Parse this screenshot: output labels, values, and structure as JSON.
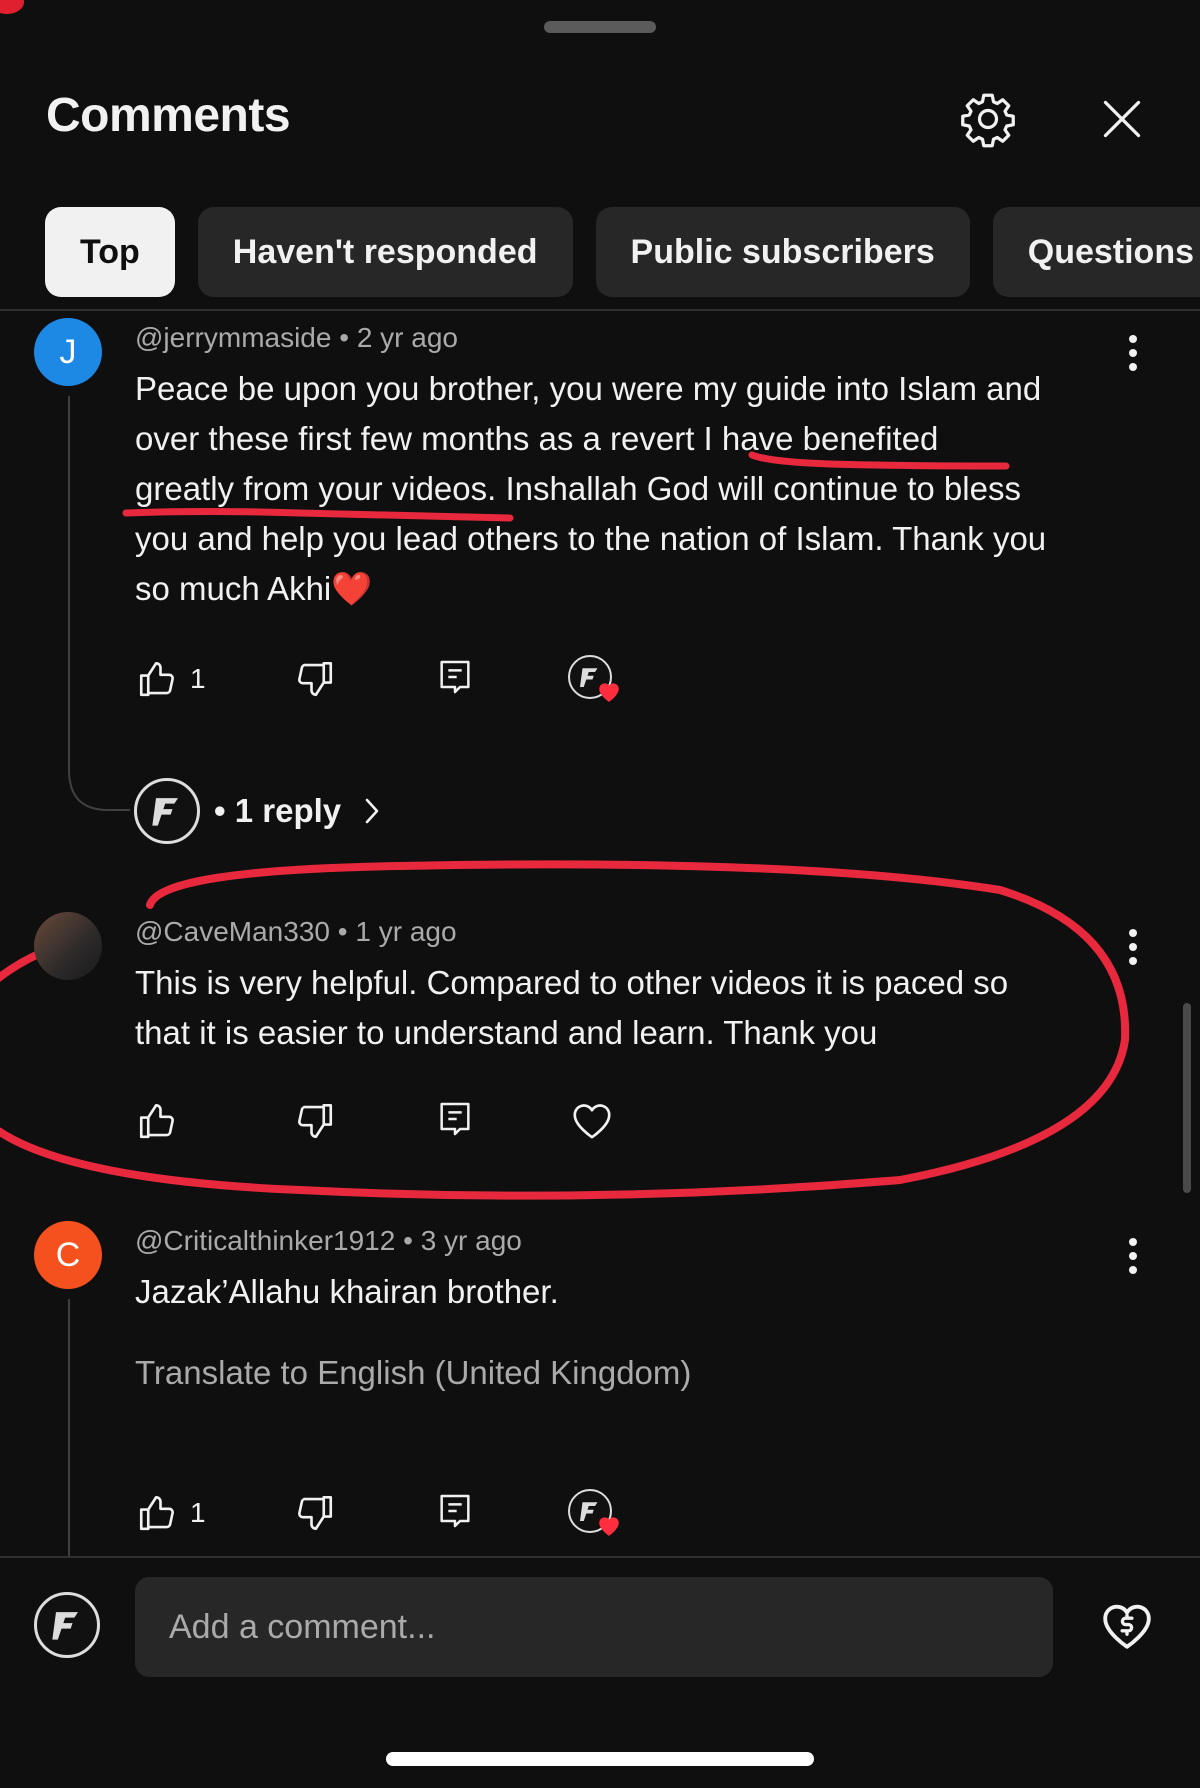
{
  "header": {
    "title": "Comments",
    "settings_icon": "gear-icon",
    "close_icon": "close-icon"
  },
  "filters": [
    {
      "label": "Top",
      "active": true
    },
    {
      "label": "Haven't responded",
      "active": false
    },
    {
      "label": "Public subscribers",
      "active": false
    },
    {
      "label": "Questions",
      "active": false
    }
  ],
  "comments": [
    {
      "avatar_letter": "J",
      "avatar_color": "#1e88e5",
      "author": "@jerrymmaside",
      "time": "2 yr ago",
      "text": "Peace be upon you brother, you were my guide into Islam and over these first few months as a revert I have benefited greatly from your videos. Inshallah God will continue to bless you and help you lead others to the nation of Islam. Thank you so much Akhi",
      "lines": [
        "Peace be upon you brother, you were my guide into Islam and",
        "over these first few months as a revert I have benefited",
        "greatly from your videos. Inshallah God will continue to bless",
        "you and help you lead others to the nation of Islam. Thank you",
        "so much Akhi"
      ],
      "emoji": "❤️",
      "likes": "1",
      "creator_hearted": true,
      "replies_label": "1 reply"
    },
    {
      "avatar_letter": "",
      "author": "@CaveMan330",
      "time": "1 yr ago",
      "lines": [
        "This is very helpful. Compared to other videos it is paced so",
        "that it is easier to understand and learn. Thank you"
      ],
      "likes": "",
      "creator_hearted": false
    },
    {
      "avatar_letter": "C",
      "avatar_color": "#f4511e",
      "author": "@Criticalthinker1912",
      "time": "3 yr ago",
      "lines": [
        "Jazak’Allahu khairan brother."
      ],
      "translate_label": "Translate to English (United Kingdom)",
      "likes": "1",
      "creator_hearted": true
    }
  ],
  "composer": {
    "placeholder": "Add a comment...",
    "thanks_icon": "super-thanks-icon"
  },
  "colors": {
    "background": "#0f0f0f",
    "annotation_red": "#e8283c",
    "heart_red": "#ff2d3d"
  }
}
